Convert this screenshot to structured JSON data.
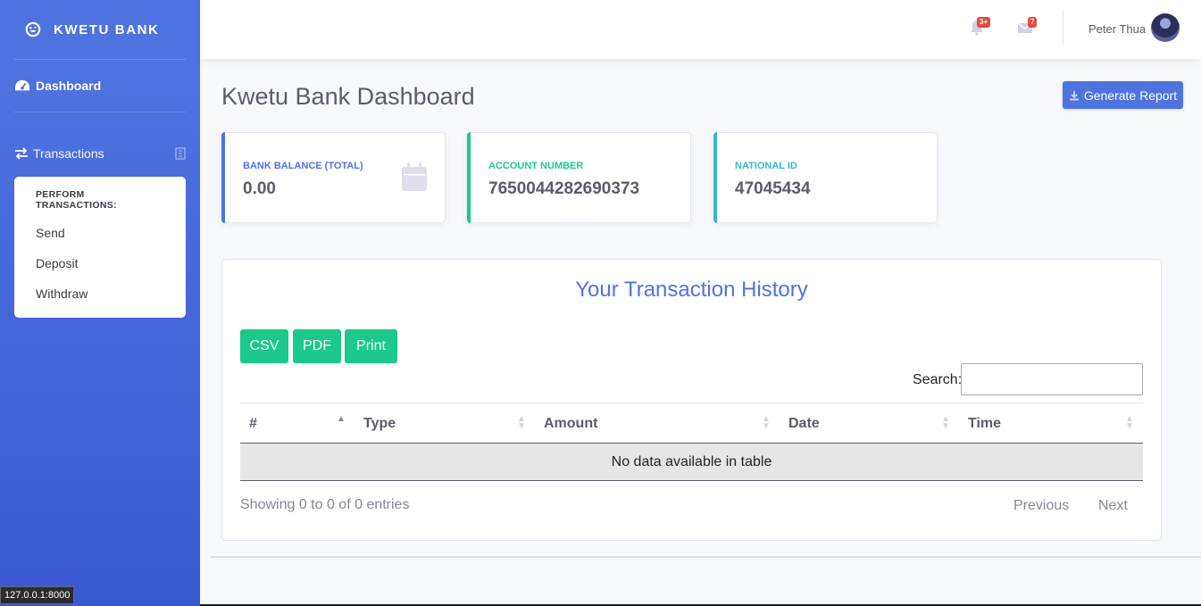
{
  "sidebar": {
    "brand": "KWETU BANK",
    "dashboard_label": "Dashboard",
    "transactions_label": "Transactions",
    "collapse": {
      "header": "PERFORM TRANSACTIONS:",
      "items": [
        {
          "label": "Send"
        },
        {
          "label": "Deposit"
        },
        {
          "label": "Withdraw"
        }
      ]
    }
  },
  "topbar": {
    "alerts_badge": "3+",
    "messages_badge": "7",
    "user_name": "Peter Thua"
  },
  "header": {
    "title": "Kwetu Bank Dashboard",
    "report_button": "Generate Report"
  },
  "cards": [
    {
      "label": "BANK BALANCE (TOTAL)",
      "value": "0.00",
      "color": "#4e73df"
    },
    {
      "label": "ACCOUNT NUMBER",
      "value": "7650044282690373",
      "color": "#1cc88a"
    },
    {
      "label": "NATIONAL ID",
      "value": "47045434",
      "color": "#36b9cc"
    }
  ],
  "history": {
    "title": "Your Transaction History",
    "export_buttons": [
      "CSV",
      "PDF",
      "Print"
    ],
    "search_label": "Search:",
    "search_value": "",
    "columns": [
      "#",
      "Type",
      "Amount",
      "Date",
      "Time"
    ],
    "empty_message": "No data available in table",
    "info": "Showing 0 to 0 of 0 entries",
    "prev": "Previous",
    "next": "Next"
  },
  "status_bar": {
    "url": "127.0.0.1:8000"
  },
  "colors": {
    "primary": "#4e73df",
    "success": "#1cc88a",
    "info": "#36b9cc",
    "danger": "#e74a3b"
  }
}
